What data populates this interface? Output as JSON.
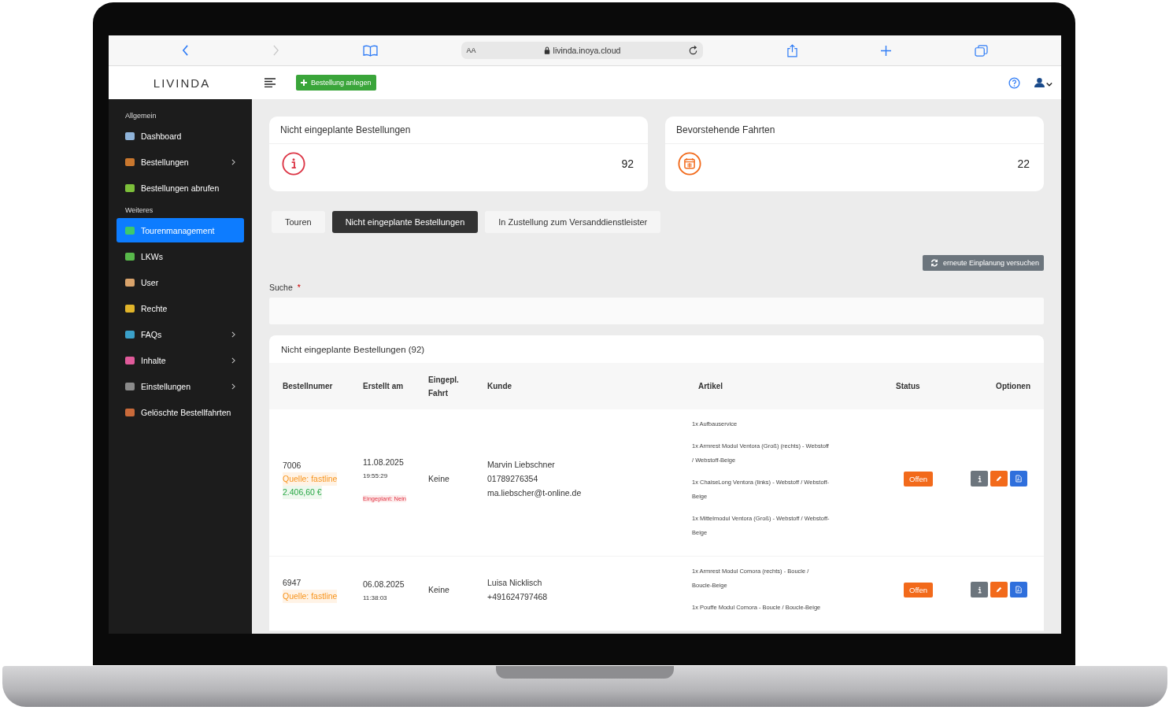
{
  "browser": {
    "text_size": "AA",
    "url": "livinda.inoya.cloud"
  },
  "header": {
    "logo": "LIVINDA",
    "new_order_button": "Bestellung anlegen"
  },
  "sidebar": {
    "sections": [
      {
        "heading": "Allgemein",
        "items": [
          {
            "label": "Dashboard",
            "selected": false,
            "has_submenu": false
          },
          {
            "label": "Bestellungen",
            "selected": false,
            "has_submenu": true
          },
          {
            "label": "Bestellungen abrufen",
            "selected": false,
            "has_submenu": false
          }
        ]
      },
      {
        "heading": "Weiteres",
        "items": [
          {
            "label": "Tourenmanagement",
            "selected": true,
            "has_submenu": false
          },
          {
            "label": "LKWs",
            "selected": false,
            "has_submenu": false
          },
          {
            "label": "User",
            "selected": false,
            "has_submenu": false
          },
          {
            "label": "Rechte",
            "selected": false,
            "has_submenu": false
          },
          {
            "label": "FAQs",
            "selected": false,
            "has_submenu": true
          },
          {
            "label": "Inhalte",
            "selected": false,
            "has_submenu": true
          },
          {
            "label": "Einstellungen",
            "selected": false,
            "has_submenu": true
          },
          {
            "label": "Gelöschte Bestellfahrten",
            "selected": false,
            "has_submenu": false
          }
        ]
      }
    ]
  },
  "stat_cards": [
    {
      "title": "Nicht eingeplante Bestellungen",
      "value": "92",
      "kind": "info"
    },
    {
      "title": "Bevorstehende Fahrten",
      "value": "22",
      "kind": "calendar"
    }
  ],
  "tabs": [
    {
      "label": "Touren",
      "selected": false
    },
    {
      "label": "Nicht eingeplante Bestellungen",
      "selected": true
    },
    {
      "label": "In Zustellung zum Versanddienstleister",
      "selected": false
    }
  ],
  "retry_button": "erneute Einplanung versuchen",
  "search": {
    "label": "Suche",
    "required_mark": "*"
  },
  "table": {
    "title": "Nicht eingeplante Bestellungen (92)",
    "columns": [
      "Bestellnumer",
      "Erstellt am",
      "Eingepl. Fahrt",
      "Kunde",
      "Artikel",
      "Status",
      "Optionen"
    ],
    "rows": [
      {
        "order_number": "7006",
        "source": "Quelle: fastline",
        "total": "2.406,60 €",
        "date": "11.08.2025",
        "time": "19:55:29",
        "planned": "Eingeplant: Nein",
        "trip": "Keine",
        "customer": [
          "Marvin Liebschner",
          "01789276354",
          "ma.liebscher@t-online.de"
        ],
        "articles": [
          "1x Aufbauservice",
          "1x Armrest Modul Ventora (Groß) (rechts) - Webstoff / Webstoff-Beige",
          "1x ChaiseLong Ventora (links) - Webstoff / Webstoff-Beige",
          "1x Mittelmodul Ventora (Groß) - Webstoff / Webstoff-Beige"
        ],
        "status": "Offen"
      },
      {
        "order_number": "6947",
        "source": "Quelle: fastline",
        "date": "06.08.2025",
        "time": "11:38:03",
        "trip": "Keine",
        "customer": [
          "Luisa Nicklisch",
          "+491624797468"
        ],
        "articles": [
          "1x Armrest Modul Comora (rechts) - Boucle / Boucle-Beige",
          "1x Pouffe Modul Comora - Boucle / Boucle-Beige"
        ],
        "status": "Offen"
      }
    ]
  }
}
